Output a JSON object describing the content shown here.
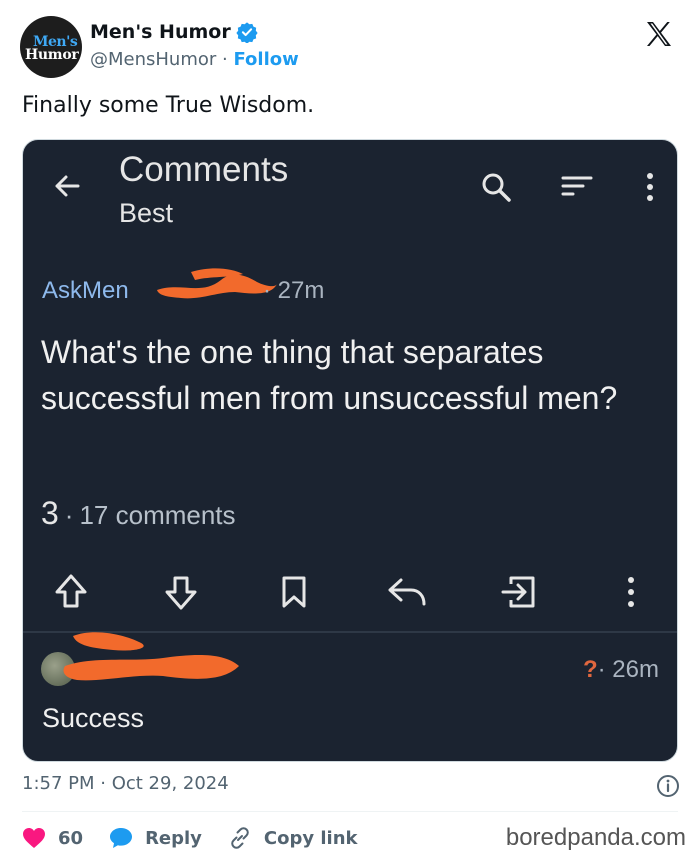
{
  "account": {
    "display_name": "Men's Humor",
    "handle": "@MensHumor",
    "separator": "·",
    "follow_label": "Follow",
    "avatar_logo_top": "Men's",
    "avatar_logo_bottom": "Humor"
  },
  "tweet": {
    "text": "Finally some True Wisdom."
  },
  "screenshot": {
    "title": "Comments",
    "sort": "Best",
    "post": {
      "author": "AskMen",
      "time": "· 27m",
      "question": "What's the one thing that separates successful men from unsuccessful men?",
      "score": "3",
      "dot": "·",
      "comments": "17 comments"
    },
    "comment": {
      "score": "?",
      "time": "· 26m",
      "text": "Success"
    }
  },
  "meta": {
    "timestamp": "1:57 PM · Oct 29, 2024"
  },
  "footer": {
    "like_count": "60",
    "reply_label": "Reply",
    "copy_label": "Copy link"
  },
  "watermark": "boredpanda.com",
  "colors": {
    "accent": "#1d9bf0",
    "like": "#f91880",
    "app_bg": "#1b2330",
    "username": "#8eb9ec",
    "redaction": "#f26a2c"
  },
  "icons": [
    "verified-badge-icon",
    "x-logo-icon",
    "back-arrow-icon",
    "search-icon",
    "sort-icon",
    "more-vertical-icon",
    "upvote-icon",
    "downvote-icon",
    "bookmark-icon",
    "reply-icon",
    "share-icon",
    "info-icon",
    "heart-icon",
    "speech-bubble-icon",
    "link-icon"
  ]
}
